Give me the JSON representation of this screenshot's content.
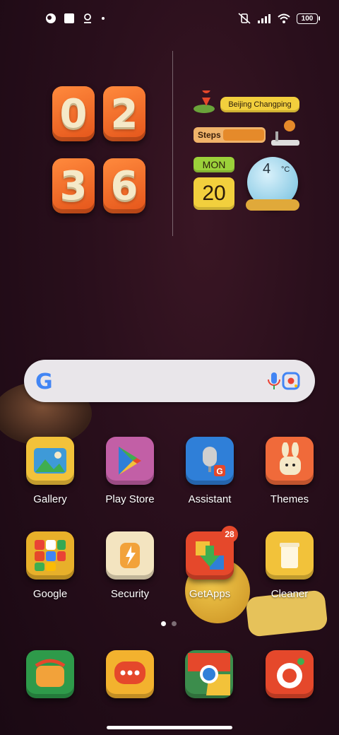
{
  "status_bar": {
    "battery": "100",
    "left_icons": [
      "notification-icon",
      "square-icon",
      "location-icon",
      "dot-icon"
    ],
    "right_icons": [
      "vibrate-off-icon",
      "signal-icon",
      "wifi-icon",
      "battery-icon"
    ]
  },
  "clock": {
    "h1": "0",
    "h2": "2",
    "m1": "3",
    "m2": "6"
  },
  "widget": {
    "location": "Beijing Changping",
    "steps_label": "Steps",
    "day": "MON",
    "date": "20",
    "temperature": "4",
    "temp_unit": "°C"
  },
  "search": {
    "logo": "G"
  },
  "apps_row1": [
    {
      "name": "Gallery",
      "color": "#f2c23a"
    },
    {
      "name": "Play Store",
      "color": "#c25fa6"
    },
    {
      "name": "Assistant",
      "color": "#2f7fd8"
    },
    {
      "name": "Themes",
      "color": "#f06a3a"
    }
  ],
  "apps_row2": [
    {
      "name": "Google",
      "color": "#e8b02a"
    },
    {
      "name": "Security",
      "color": "#f3e4c0"
    },
    {
      "name": "GetApps",
      "color": "#e5482b",
      "badge": "28"
    },
    {
      "name": "Cleaner",
      "color": "#f2c23a"
    }
  ],
  "dock": [
    {
      "name": "phone-dock-icon",
      "color": "#2e9a4a"
    },
    {
      "name": "messages-dock-icon",
      "color": "#f3b22e"
    },
    {
      "name": "chrome-dock-icon",
      "color": "#3c8d4c"
    },
    {
      "name": "camera-dock-icon",
      "color": "#e5482b"
    }
  ],
  "pager": {
    "pages": 2,
    "active": 1
  }
}
